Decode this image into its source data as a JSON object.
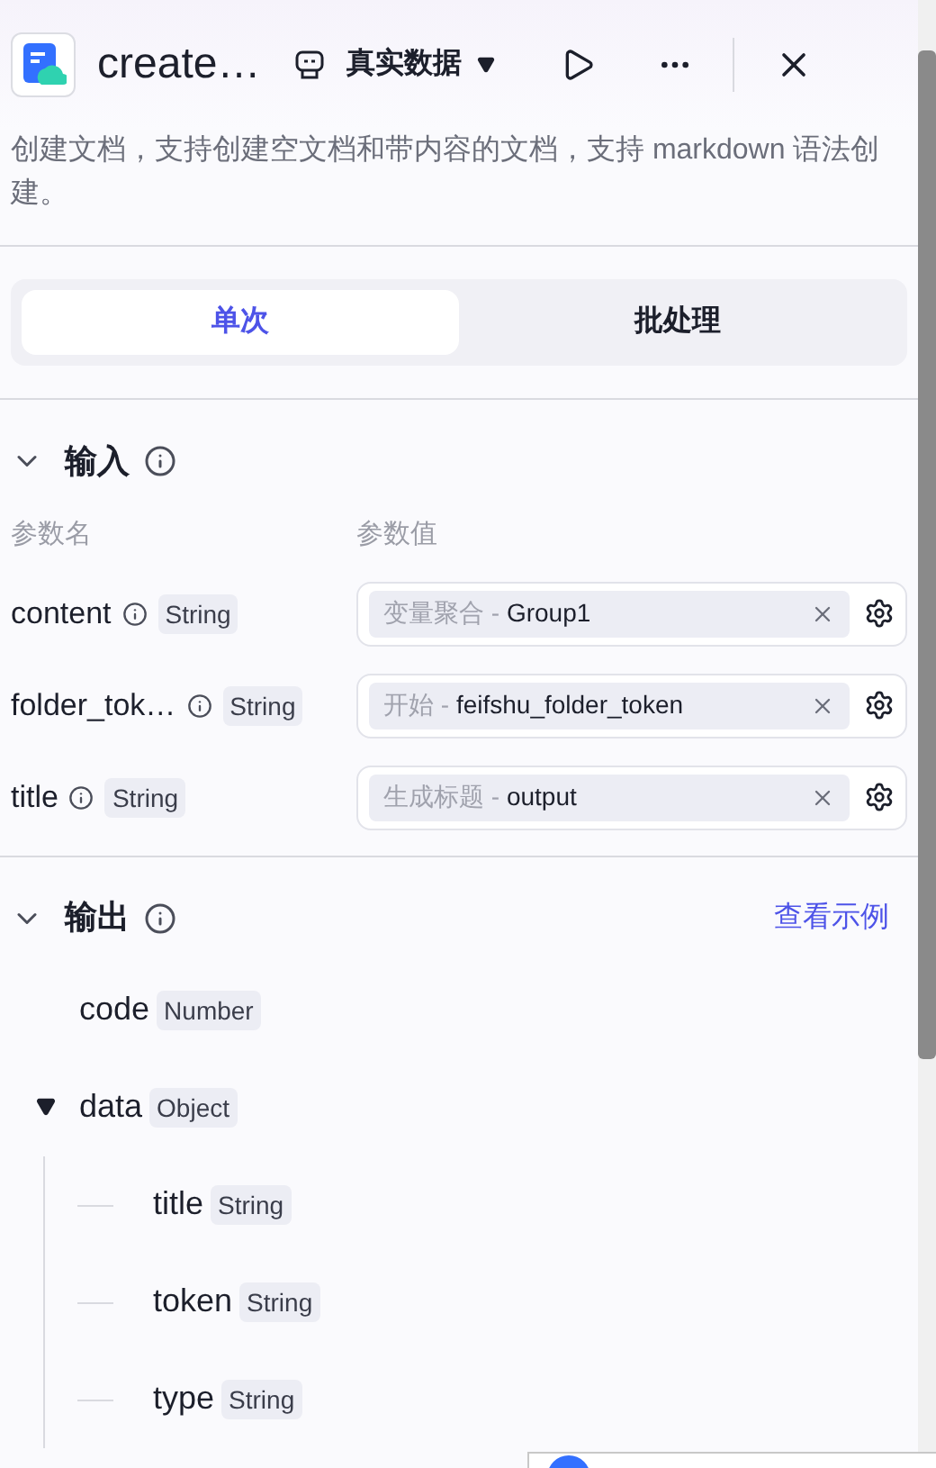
{
  "header": {
    "title": "create…",
    "data_source": "真实数据"
  },
  "description": "创建文档，支持创建空文档和带内容的文档，支持 markdown 语法创建。",
  "tabs": [
    {
      "label": "单次",
      "selected": true
    },
    {
      "label": "批处理",
      "selected": false
    }
  ],
  "input": {
    "title": "输入",
    "expanded": true,
    "columns": [
      "参数名",
      "参数值"
    ],
    "params": [
      {
        "name": "content",
        "type": "String",
        "source": "变量聚合 -",
        "variable": "Group1"
      },
      {
        "name": "folder_tok…",
        "type": "String",
        "source": "开始 -",
        "variable": "feifshu_folder_token"
      },
      {
        "name": "title",
        "type": "String",
        "source": "生成标题 -",
        "variable": "output"
      }
    ]
  },
  "output": {
    "title": "输出",
    "expanded": true,
    "example_link": "查看示例",
    "fields": [
      {
        "name": "code",
        "type": "Number"
      },
      {
        "name": "data",
        "type": "Object",
        "expanded": true,
        "children": [
          {
            "name": "title",
            "type": "String"
          },
          {
            "name": "token",
            "type": "String"
          },
          {
            "name": "type",
            "type": "String"
          }
        ]
      }
    ]
  }
}
